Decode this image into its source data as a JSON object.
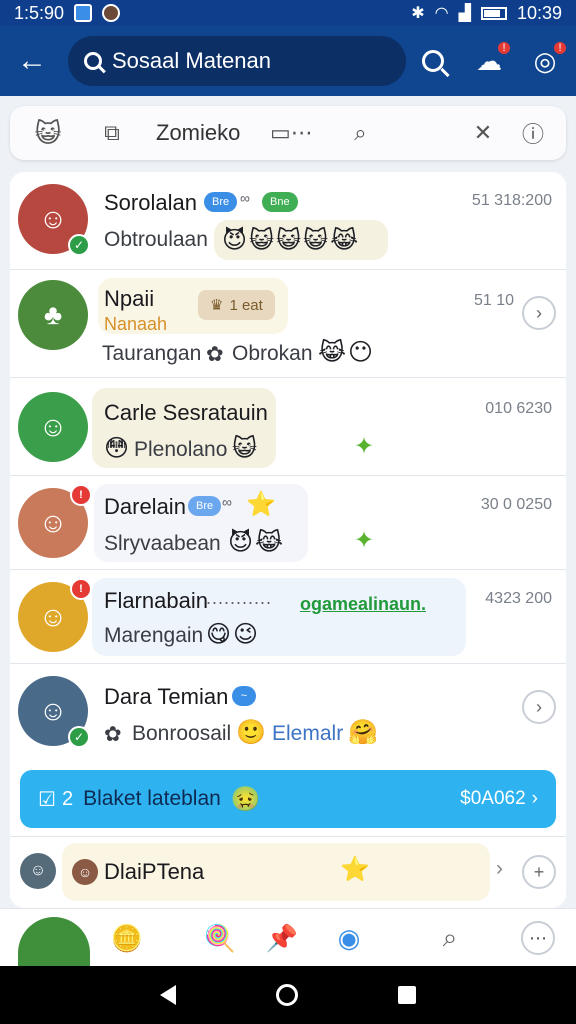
{
  "status_bar": {
    "left_time": "1:5:90",
    "right_time": "10:39"
  },
  "app_bar": {
    "search_text": "Sosaal Matenan",
    "notification_badge": "!",
    "profile_badge": "!"
  },
  "toolbar": {
    "label": "Zomieko"
  },
  "chats": [
    {
      "name": "Sorolalan",
      "chip1": "Bre",
      "chip2": "Bne",
      "chip_sep": "∞",
      "message": "Obtroulaan",
      "emojis": "😈😺😺😺😹",
      "time": "51 318:200",
      "avatar_color": "#b7483f"
    },
    {
      "name": "Npaii",
      "subname": "Nanaah",
      "tag": "1 eat",
      "message": "Taurangan",
      "message2": "Obrokan",
      "emojis": "😹😶",
      "time": "51 10",
      "avatar_color": "#4b8b3b"
    },
    {
      "name": "Carle Sesratauin",
      "message": "Plenolano",
      "emojis": "😺",
      "time": "010 6230",
      "avatar_color": "#3a9e4a"
    },
    {
      "name": "Darelain",
      "chip1": "Bre",
      "chip_sep": "∞",
      "message": "Slryvaabean",
      "emojis": "😈😹",
      "time": "30 0 0250",
      "avatar_color": "#c97a5a",
      "badge": "!"
    },
    {
      "name": "Flarnabain",
      "dots": "...........",
      "link": "ogamealinaun.",
      "message": "Marengain",
      "emojis": "😋😉",
      "time": "4323 200",
      "avatar_color": "#e0a82a",
      "badge": "!"
    },
    {
      "name": "Dara Temian",
      "message": "Bonroosail",
      "message2": "Elemalr",
      "emojis": "🤗",
      "time": "",
      "avatar_color": "#4a6a8a"
    }
  ],
  "banner": {
    "count": "2",
    "label": "Blaket lateblan",
    "amount": "$0A062"
  },
  "last_chat": {
    "name": "DlaiPTena",
    "avatar_color": "#556b7a"
  },
  "colors": {
    "primary": "#10458f",
    "accent": "#2fb3f0",
    "badge": "#e53935",
    "online": "#2e9d48"
  }
}
